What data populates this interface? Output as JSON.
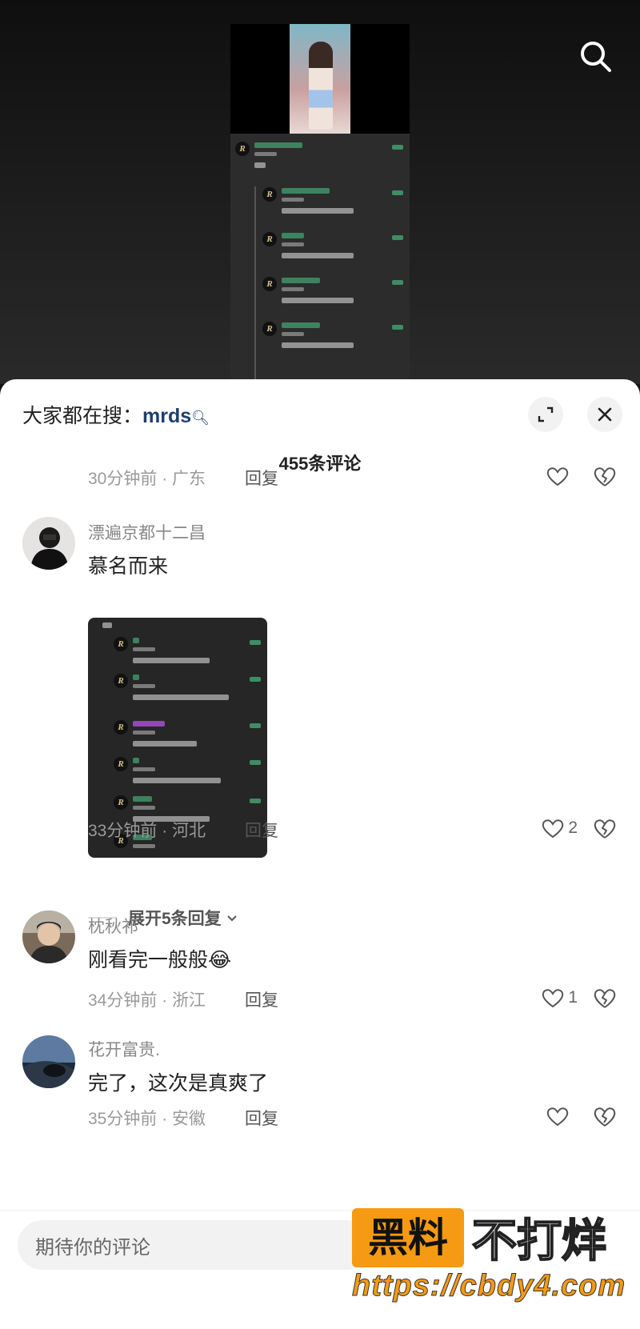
{
  "trending": {
    "prefix": "大家都在搜：",
    "keyword": "mrds"
  },
  "comments_header": {
    "count_label": "455条评论"
  },
  "reply_label": "回复",
  "comments": [
    {
      "meta": "30分钟前 · 广东"
    },
    {
      "username": "漂遍京都十二昌",
      "text": "慕名而来",
      "meta": "33分钟前 · 河北",
      "likes": "2",
      "expand_label": "展开5条回复"
    },
    {
      "username": "枕秋祁",
      "text": "刚看完一般般",
      "emoji": "😂",
      "meta": "34分钟前 · 浙江",
      "likes": "1"
    },
    {
      "username": "花开富贵.",
      "text": "完了，这次是真爽了",
      "meta": "35分钟前 · 安徽"
    }
  ],
  "input": {
    "placeholder": "期待你的评论"
  },
  "watermark": {
    "label": "黑料",
    "slogan": "不打烊",
    "url": "https://cbdy4.com"
  },
  "icons": {
    "search": "search-icon",
    "expand": "expand-icon",
    "close": "close-icon",
    "like": "heart-icon",
    "dislike": "broken-heart-icon",
    "chevron": "chevron-down-icon"
  },
  "colors": {
    "keyword": "#1f3f6e",
    "watermark_orange": "#f59a12",
    "sheet_bg": "#ffffff"
  }
}
